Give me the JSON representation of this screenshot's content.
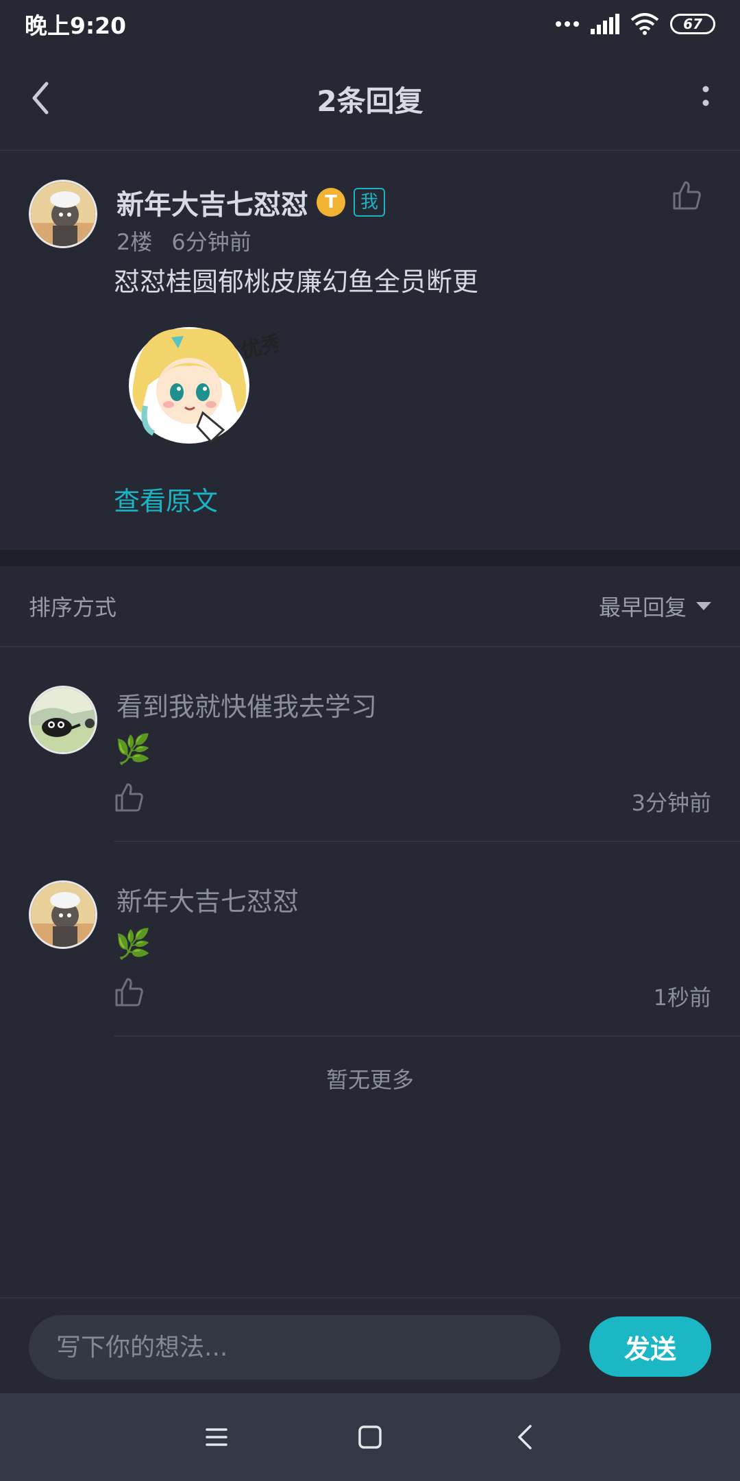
{
  "status_bar": {
    "time": "晚上9:20",
    "battery": "67"
  },
  "header": {
    "title": "2条回复"
  },
  "post": {
    "author": "新年大吉七怼怼",
    "level_badge": "T",
    "me_tag": "我",
    "floor": "2楼",
    "time": "6分钟前",
    "text": "怼怼桂圆郁桃皮廉幻鱼全员断更",
    "sticker_text": "优秀",
    "view_original": "查看原文"
  },
  "sort": {
    "label": "排序方式",
    "selected": "最早回复"
  },
  "replies": [
    {
      "name": "看到我就快催我去学习",
      "emoji": "🌿",
      "time": "3分钟前"
    },
    {
      "name": "新年大吉七怼怼",
      "emoji": "🌿",
      "time": "1秒前"
    }
  ],
  "no_more": "暂无更多",
  "composer": {
    "placeholder": "写下你的想法...",
    "send": "发送"
  },
  "colors": {
    "accent": "#1bb7c4",
    "background": "#262833"
  }
}
